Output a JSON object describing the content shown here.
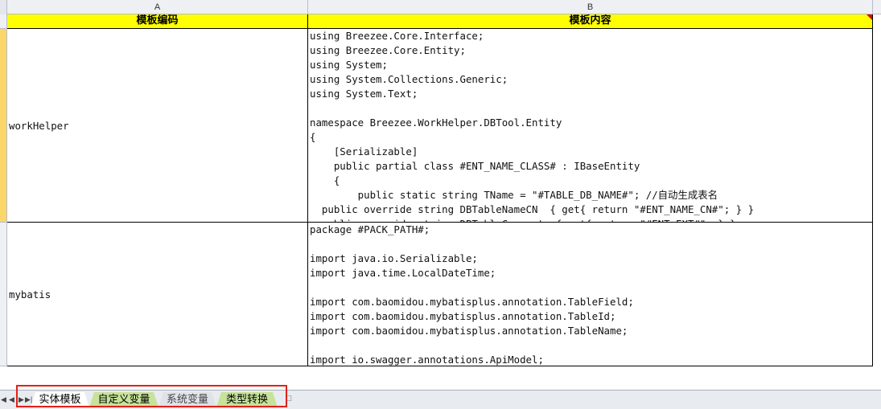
{
  "columns": [
    "A",
    "B"
  ],
  "header_row": {
    "a_label": "模板编码",
    "b_label": "模板内容"
  },
  "rows": [
    {
      "code": "workHelper",
      "content_lines": [
        "using Breezee.Core.Interface;",
        "using Breezee.Core.Entity;",
        "using System;",
        "using System.Collections.Generic;",
        "using System.Text;",
        "",
        "namespace Breezee.WorkHelper.DBTool.Entity",
        "{",
        "    [Serializable]",
        "    public partial class #ENT_NAME_CLASS# : IBaseEntity",
        "    {",
        "        public static string TName = \"#TABLE_DB_NAME#\"; //自动生成表名",
        "  public override string DBTableNameCN  { get{ return \"#ENT_NAME_CN#\"; } }",
        "  public override string DBTableComment  { get{ return \"#ENT_EXT#\"; } }"
      ]
    },
    {
      "code": "mybatis",
      "content_lines": [
        "package #PACK_PATH#;",
        "",
        "import java.io.Serializable;",
        "import java.time.LocalDateTime;",
        "",
        "import com.baomidou.mybatisplus.annotation.TableField;",
        "import com.baomidou.mybatisplus.annotation.TableId;",
        "import com.baomidou.mybatisplus.annotation.TableName;",
        "",
        "import io.swagger.annotations.ApiModel;"
      ]
    }
  ],
  "sheet_tabs": [
    {
      "label": "实体模板",
      "state": "active"
    },
    {
      "label": "自定义变量",
      "state": "green"
    },
    {
      "label": "系统变量",
      "state": "gray"
    },
    {
      "label": "类型转换",
      "state": "green"
    }
  ],
  "colors": {
    "header_fill": "#ffff00",
    "selected_row_header": "#fbd76a",
    "tab_green": "#c7e39a",
    "highlight_box": "#e0211a"
  }
}
